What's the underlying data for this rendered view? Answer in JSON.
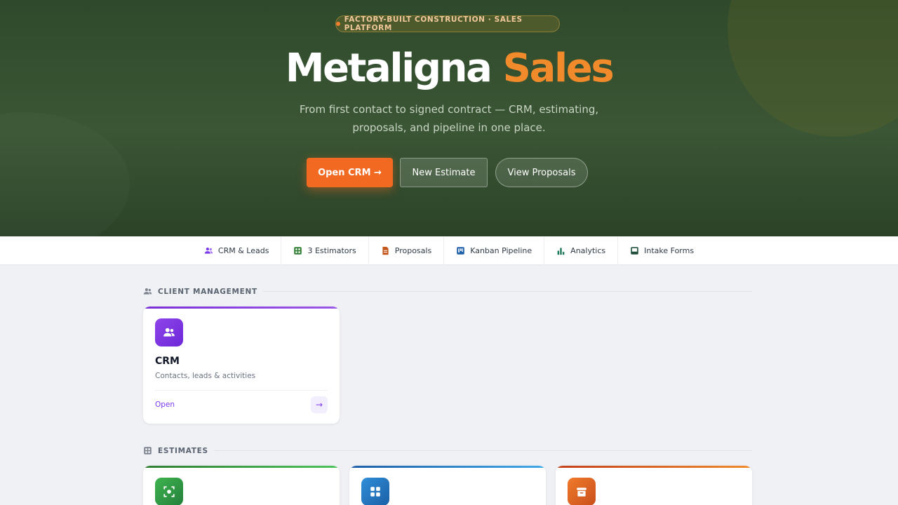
{
  "hero": {
    "badge": "FACTORY-BUILT CONSTRUCTION · SALES PLATFORM",
    "title_main": "Metaligna",
    "title_accent": "Sales",
    "subtitle": "From first contact to signed contract — CRM, estimating, proposals, and pipeline in one place.",
    "buttons": {
      "open_crm": "Open CRM →",
      "new_estimate": "New Estimate",
      "view_proposals": "View Proposals"
    }
  },
  "nav": {
    "items": [
      {
        "label": "CRM & Leads",
        "icon": "users-icon",
        "color": "#7c3aed"
      },
      {
        "label": "3 Estimators",
        "icon": "grid-table-icon",
        "color": "#2e7d32"
      },
      {
        "label": "Proposals",
        "icon": "document-icon",
        "color": "#c2561b"
      },
      {
        "label": "Kanban Pipeline",
        "icon": "kanban-icon",
        "color": "#1d5fa8"
      },
      {
        "label": "Analytics",
        "icon": "bar-chart-icon",
        "color": "#1f7a5c"
      },
      {
        "label": "Intake Forms",
        "icon": "inbox-icon",
        "color": "#1f4f3a"
      }
    ]
  },
  "sections": {
    "client": {
      "label": "CLIENT MANAGEMENT",
      "card": {
        "title": "CRM",
        "description": "Contacts, leads & activities",
        "open_label": "Open",
        "arrow": "→",
        "accent": "#8b3fe0"
      }
    },
    "estimates": {
      "label": "ESTIMATES",
      "cards": [
        {
          "icon": "scan-icon",
          "accent": "#2e9c46"
        },
        {
          "icon": "apps-grid-icon",
          "accent": "#2384c7"
        },
        {
          "icon": "archive-icon",
          "accent": "#e06a1f"
        }
      ]
    }
  }
}
